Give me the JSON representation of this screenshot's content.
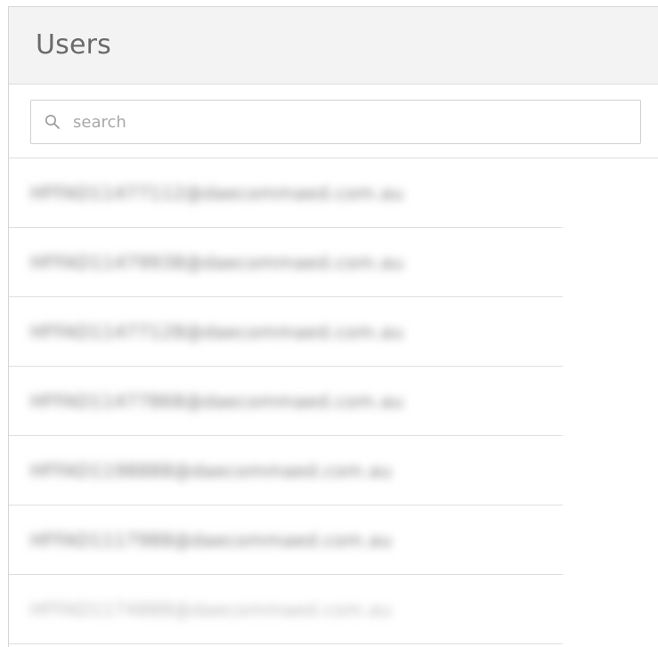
{
  "panel": {
    "title": "Users"
  },
  "search": {
    "placeholder": "search",
    "value": ""
  },
  "users": [
    {
      "email": "HFFAD11477112@daecommaed.com.au"
    },
    {
      "email": "HFFAD11479938@daecommaed.com.au"
    },
    {
      "email": "HFFAD11477128@daecommaed.com.au"
    },
    {
      "email": "HFFAD11477868@daecommaed.com.au"
    },
    {
      "email": "HFFAD1198888@daecommaed.com.au"
    },
    {
      "email": "HFFAD1117988@daecommaed.com.au"
    },
    {
      "email": "HFFAD1174888@daecommaed.com.au"
    }
  ],
  "icons": {
    "search": "search-icon"
  },
  "colors": {
    "header_bg": "#f3f3f3",
    "border": "#dcdcdc",
    "title_text": "#6a6a6a",
    "placeholder_text": "#a8a8a8"
  }
}
